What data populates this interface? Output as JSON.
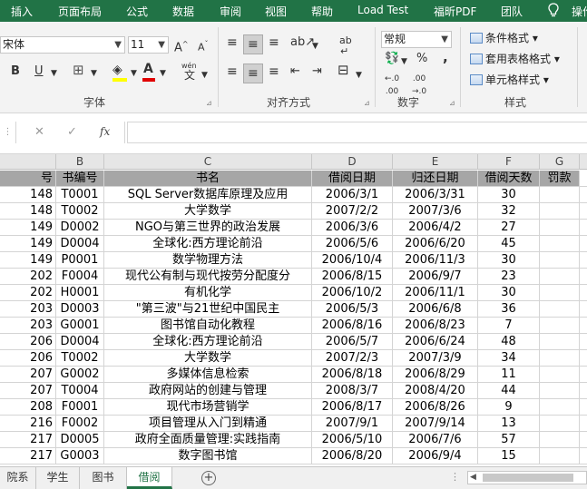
{
  "ribbon_tabs": [
    "插入",
    "页面布局",
    "公式",
    "数据",
    "审阅",
    "视图",
    "帮助",
    "Load Test",
    "福昕PDF",
    "团队",
    "操作"
  ],
  "ribbon": {
    "font_name": "宋体",
    "font_size": "11",
    "font_group_label": "字体",
    "align_group_label": "对齐方式",
    "number_format": "常规",
    "number_group_label": "数字",
    "styles_group_label": "样式",
    "conditional_format": "条件格式",
    "table_format": "套用表格格式",
    "cell_styles": "单元格样式",
    "bold": "B",
    "underline": "U",
    "font_grow": "A",
    "font_shrink": "A",
    "percent": "%",
    "comma": ",",
    "wen": "wén",
    "wen_char": "文",
    "ab": "ab",
    "font_color_A": "A"
  },
  "formula_bar": {
    "cancel": "✕",
    "enter": "✓",
    "fx": "fx",
    "value": ""
  },
  "columns": [
    "B",
    "C",
    "D",
    "E",
    "F",
    "G"
  ],
  "table": {
    "headers": [
      "号",
      "书编号",
      "书名",
      "借阅日期",
      "归还日期",
      "借阅天数",
      "罚款"
    ],
    "rows": [
      [
        "148",
        "T0001",
        "SQL Server数据库原理及应用",
        "2006/3/1",
        "2006/3/31",
        "30",
        ""
      ],
      [
        "148",
        "T0002",
        "大学数学",
        "2007/2/2",
        "2007/3/6",
        "32",
        ""
      ],
      [
        "149",
        "D0002",
        "NGO与第三世界的政治发展",
        "2006/3/6",
        "2006/4/2",
        "27",
        ""
      ],
      [
        "149",
        "D0004",
        "全球化:西方理论前沿",
        "2006/5/6",
        "2006/6/20",
        "45",
        ""
      ],
      [
        "149",
        "P0001",
        "数学物理方法",
        "2006/10/4",
        "2006/11/3",
        "30",
        ""
      ],
      [
        "202",
        "F0004",
        "现代公有制与现代按劳分配度分",
        "2006/8/15",
        "2006/9/7",
        "23",
        ""
      ],
      [
        "202",
        "H0001",
        "有机化学",
        "2006/10/2",
        "2006/11/1",
        "30",
        ""
      ],
      [
        "203",
        "D0003",
        "\"第三波\"与21世纪中国民主",
        "2006/5/3",
        "2006/6/8",
        "36",
        ""
      ],
      [
        "203",
        "G0001",
        "图书馆自动化教程",
        "2006/8/16",
        "2006/8/23",
        "7",
        ""
      ],
      [
        "206",
        "D0004",
        "全球化:西方理论前沿",
        "2006/5/7",
        "2006/6/24",
        "48",
        ""
      ],
      [
        "206",
        "T0002",
        "大学数学",
        "2007/2/3",
        "2007/3/9",
        "34",
        ""
      ],
      [
        "207",
        "G0002",
        "多媒体信息检索",
        "2006/8/18",
        "2006/8/29",
        "11",
        ""
      ],
      [
        "207",
        "T0004",
        "政府网站的创建与管理",
        "2008/3/7",
        "2008/4/20",
        "44",
        ""
      ],
      [
        "208",
        "F0001",
        "现代市场营销学",
        "2006/8/17",
        "2006/8/26",
        "9",
        ""
      ],
      [
        "216",
        "F0002",
        "项目管理从入门到精通",
        "2007/9/1",
        "2007/9/14",
        "13",
        ""
      ],
      [
        "217",
        "D0005",
        "政府全面质量管理:实践指南",
        "2006/5/10",
        "2006/7/6",
        "57",
        ""
      ],
      [
        "217",
        "G0003",
        "数字图书馆",
        "2006/8/20",
        "2006/9/4",
        "15",
        ""
      ]
    ]
  },
  "sheet_tabs": [
    "院系",
    "学生",
    "图书",
    "借阅"
  ],
  "active_sheet": "借阅",
  "add_sheet": "+",
  "colors": {
    "accent": "#217346",
    "header_fill": "#a6a6a6"
  }
}
